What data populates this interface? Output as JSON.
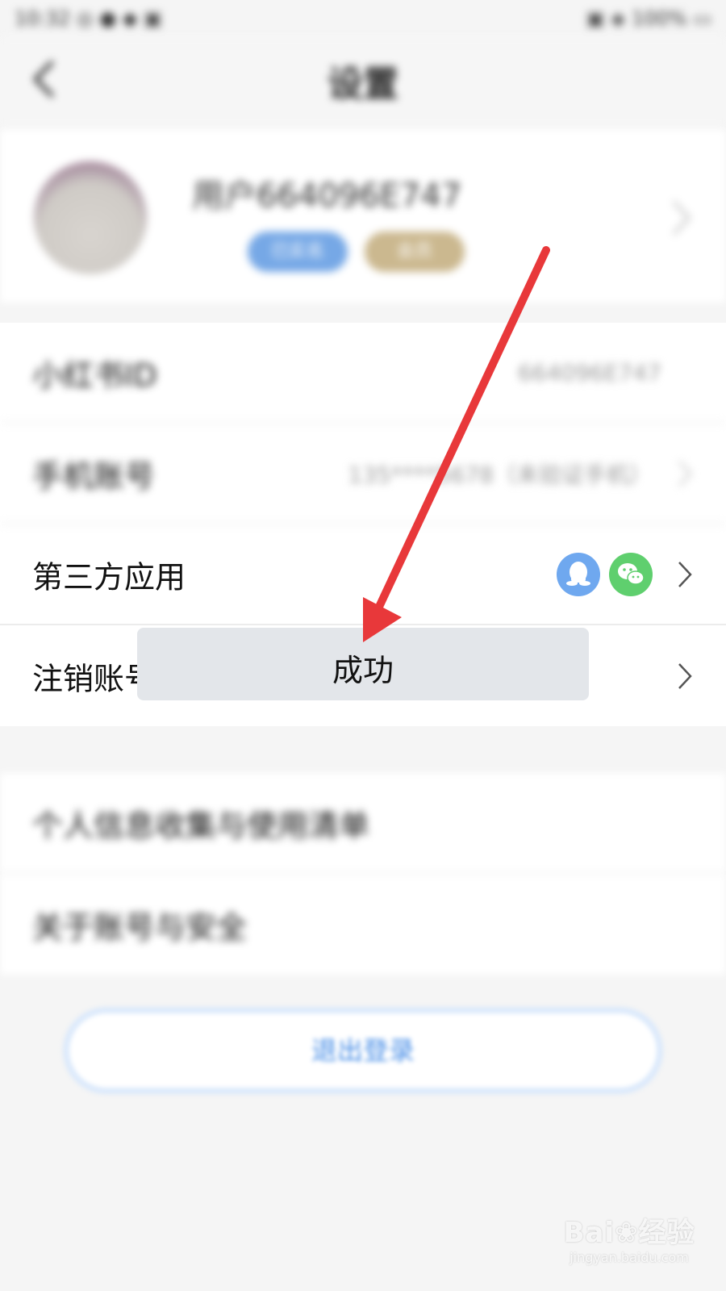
{
  "status_bar": {
    "left": "10:32 ◎ ● ◆ ▣",
    "right": "▣ ◈ 100% ▭"
  },
  "nav": {
    "title": "设置",
    "back_icon": "chevron-left-icon"
  },
  "profile": {
    "username": "用户664096E747",
    "badge_primary": "已实名",
    "badge_secondary": "会员"
  },
  "account_rows": [
    {
      "label": "小红书ID",
      "value": "664096E747"
    },
    {
      "label": "手机账号",
      "value": "135****5678（未验证手机）"
    },
    {
      "label": "第三方应用",
      "icons": [
        "qq-icon",
        "wechat-icon"
      ]
    },
    {
      "label": "注销账号"
    }
  ],
  "info_rows": [
    {
      "label": "个人信息收集与使用清单"
    },
    {
      "label": "关于账号与安全"
    }
  ],
  "logout_button": "退出登录",
  "toast": {
    "text": "成功"
  },
  "watermark": {
    "main": "Bai❀经验",
    "sub": "jingyan.baidu.com"
  },
  "colors": {
    "accent_blue": "#4a8fe7",
    "arrow_red": "#e8383a",
    "qq_blue": "#6fa8ef",
    "wechat_green": "#5fcf6e"
  }
}
